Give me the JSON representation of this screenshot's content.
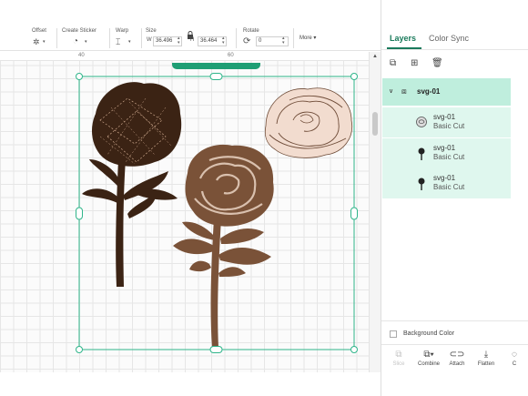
{
  "toolbar": {
    "offset_label": "Offset",
    "offset_icon": "✲",
    "sticker_label": "Create Sticker",
    "sticker_icon": "◔",
    "warp_label": "Warp",
    "warp_icon": "⌶",
    "size_label": "Size",
    "width_prefix": "W",
    "width_value": "36.496",
    "height_prefix": "H",
    "height_value": "36.464",
    "lock_icon": "lock-icon",
    "rotate_label": "Rotate",
    "rotate_value": "0",
    "more_label": "More ▾"
  },
  "ruler": {
    "mark_left": "40",
    "mark_right": "60"
  },
  "panel": {
    "tabs": [
      "Layers",
      "Color Sync"
    ],
    "group": {
      "name": "svg-01"
    },
    "layers": [
      {
        "name": "svg-01",
        "operation": "Basic Cut",
        "thumb": "rose-outline-icon"
      },
      {
        "name": "svg-01",
        "operation": "Basic Cut",
        "thumb": "rose-brown-icon"
      },
      {
        "name": "svg-01",
        "operation": "Basic Cut",
        "thumb": "rose-dark-icon"
      }
    ],
    "background_color_label": "Background Color",
    "bottom_tools": [
      {
        "label": "Slice",
        "disabled": true
      },
      {
        "label": "Combine",
        "disabled": false
      },
      {
        "label": "Attach",
        "disabled": false
      },
      {
        "label": "Flatten",
        "disabled": false
      },
      {
        "label": "C",
        "disabled": false
      }
    ]
  },
  "colors": {
    "accent": "#1a7a5b",
    "selection": "#2fb58a",
    "rose_dark": "#3b2314",
    "rose_brown": "#7a5238",
    "rose_outline": "#e9c9b6"
  }
}
